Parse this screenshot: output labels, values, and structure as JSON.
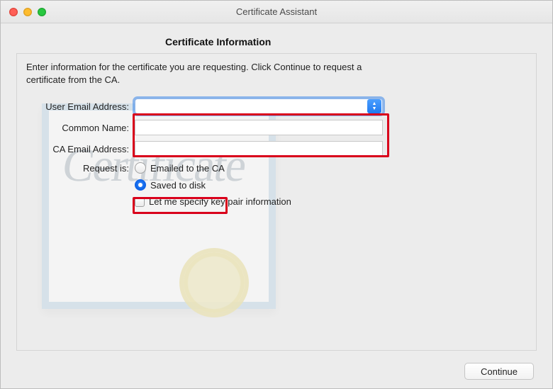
{
  "window": {
    "title": "Certificate Assistant"
  },
  "heading": "Certificate Information",
  "intro": "Enter information for the certificate you are requesting. Click Continue to request a certificate from the CA.",
  "form": {
    "user_email_label": "User Email Address:",
    "user_email_value": "",
    "common_name_label": "Common Name:",
    "common_name_value": "",
    "ca_email_label": "CA Email Address:",
    "ca_email_value": "",
    "request_is_label": "Request is:",
    "option_emailed": "Emailed to the CA",
    "option_saved": "Saved to disk",
    "option_keypair": "Let me specify key pair information",
    "selected_request": "saved"
  },
  "buttons": {
    "continue": "Continue"
  },
  "illustration": {
    "script_text": "Certificate"
  }
}
